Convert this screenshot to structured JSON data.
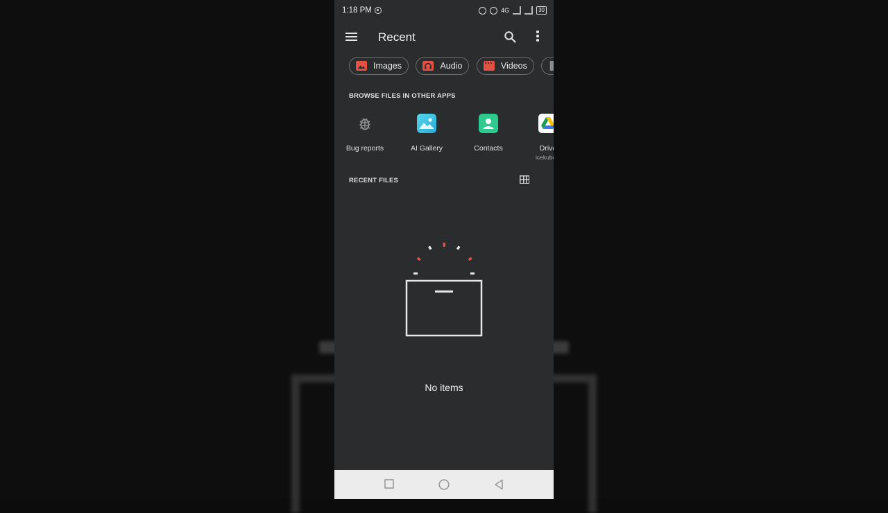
{
  "status_bar": {
    "time": "1:18 PM",
    "network_label": "4G",
    "battery": "30"
  },
  "app_bar": {
    "title": "Recent"
  },
  "chips": [
    {
      "label": "Images",
      "icon": "image-icon",
      "color": "#e35145"
    },
    {
      "label": "Audio",
      "icon": "headphones-icon",
      "color": "#e35145"
    },
    {
      "label": "Videos",
      "icon": "movie-icon",
      "color": "#e35145"
    },
    {
      "label": "",
      "icon": "document-icon",
      "color": "#8a8c8e"
    }
  ],
  "browse_section": {
    "heading": "BROWSE FILES IN OTHER APPS",
    "apps": [
      {
        "label": "Bug reports",
        "icon": "bug-icon",
        "sub": ""
      },
      {
        "label": "AI Gallery",
        "icon": "gallery-icon",
        "sub": ""
      },
      {
        "label": "Contacts",
        "icon": "contacts-icon",
        "sub": ""
      },
      {
        "label": "Drive",
        "icon": "drive-icon",
        "sub": "icekube.s"
      }
    ]
  },
  "recent_section": {
    "heading": "RECENT FILES",
    "empty_text": "No items"
  },
  "colors": {
    "background": "#2a2c2e",
    "accent_red": "#e35145",
    "gallery_teal": "#3ec6e0",
    "contacts_green": "#2ec98e"
  }
}
